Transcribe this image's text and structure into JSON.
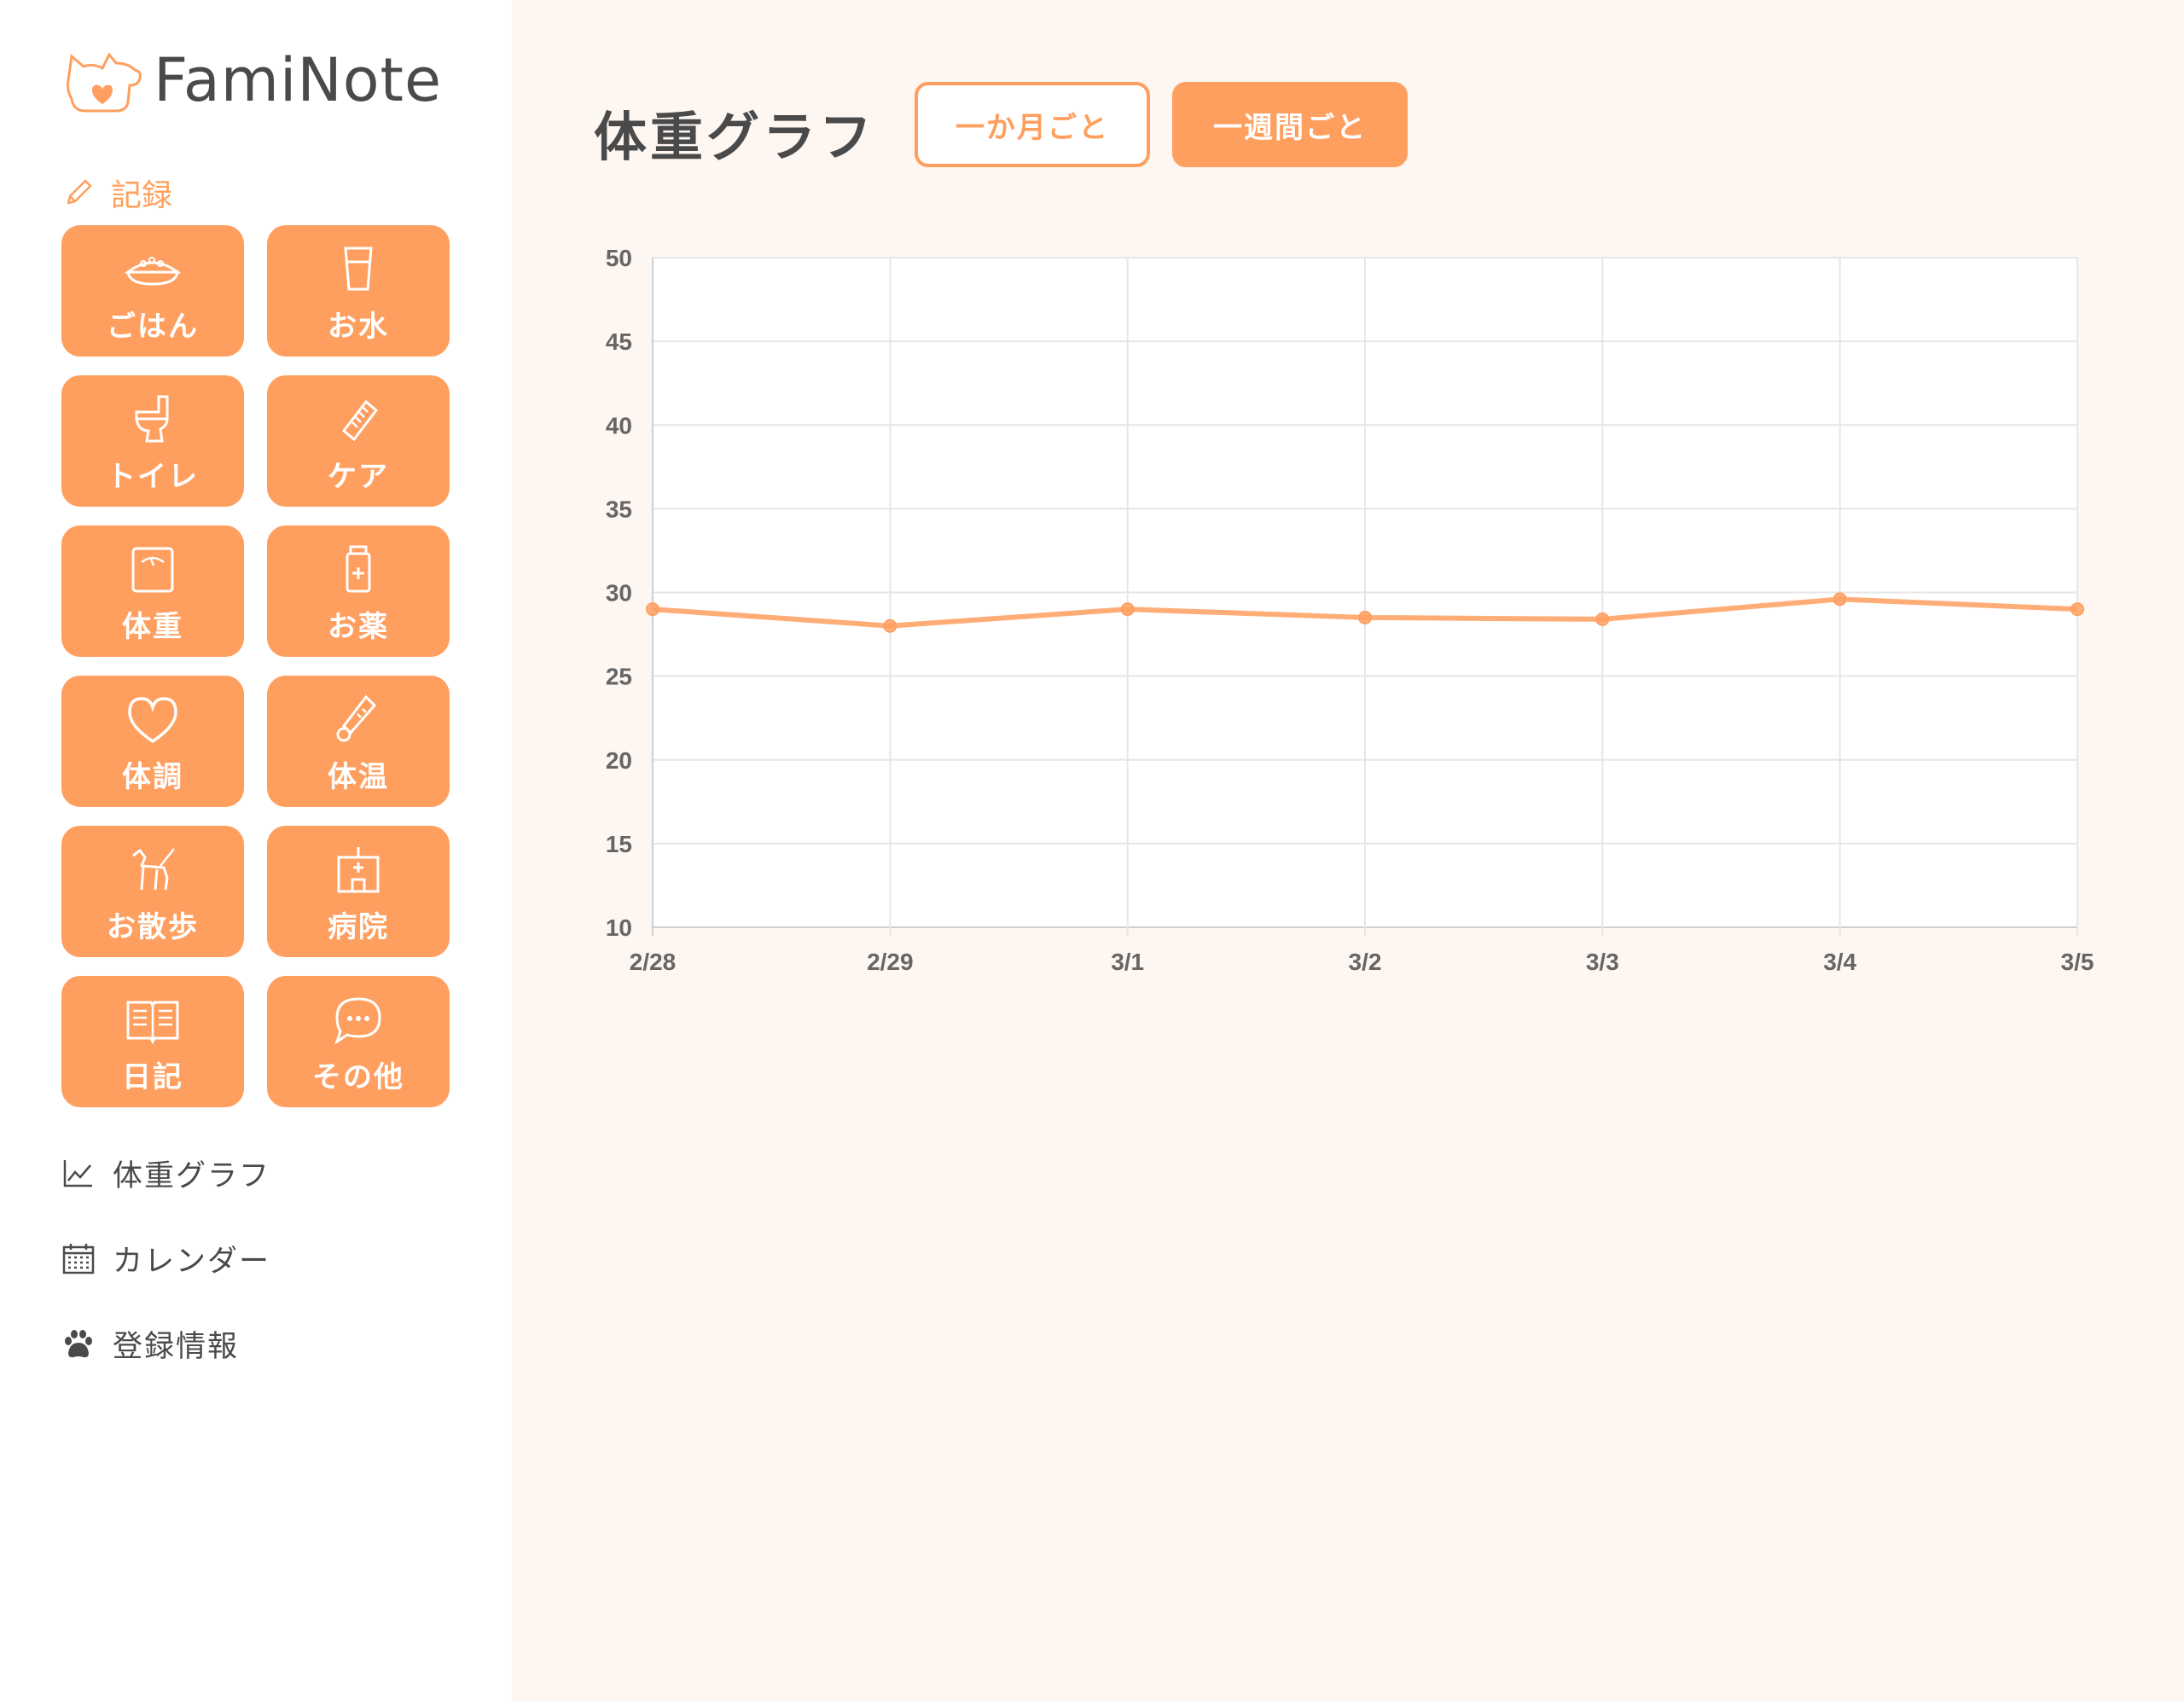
{
  "app": {
    "name": "FamiNote",
    "brand_color": "#ff9f5f",
    "logo_icon": "dog-cat-heart-logo"
  },
  "sidebar": {
    "record_section": {
      "label": "記録",
      "icon": "pencil-icon"
    },
    "tiles": [
      {
        "label": "ごはん",
        "icon": "food-bowl-icon"
      },
      {
        "label": "お水",
        "icon": "water-glass-icon"
      },
      {
        "label": "トイレ",
        "icon": "toilet-icon"
      },
      {
        "label": "ケア",
        "icon": "brush-icon"
      },
      {
        "label": "体重",
        "icon": "scale-icon"
      },
      {
        "label": "お薬",
        "icon": "medicine-bottle-icon"
      },
      {
        "label": "体調",
        "icon": "heart-icon"
      },
      {
        "label": "体温",
        "icon": "thermometer-icon"
      },
      {
        "label": "お散歩",
        "icon": "dog-walk-icon"
      },
      {
        "label": "病院",
        "icon": "hospital-icon"
      },
      {
        "label": "日記",
        "icon": "open-book-icon"
      },
      {
        "label": "その他",
        "icon": "speech-bubble-icon"
      }
    ],
    "nav": [
      {
        "label": "体重グラフ",
        "icon": "line-chart-icon"
      },
      {
        "label": "カレンダー",
        "icon": "calendar-icon"
      },
      {
        "label": "登録情報",
        "icon": "paw-icon"
      }
    ]
  },
  "main": {
    "title": "体重グラフ",
    "buttons": {
      "monthly": "一か月ごと",
      "weekly": "一週間ごと"
    },
    "selected_period": "一週間ごと"
  },
  "chart_data": {
    "type": "line",
    "categories": [
      "2/28",
      "2/29",
      "3/1",
      "3/2",
      "3/3",
      "3/4",
      "3/5"
    ],
    "series": [
      {
        "values": [
          29.0,
          28.0,
          29.0,
          28.5,
          28.4,
          29.6,
          29.0
        ],
        "color": "#ff9f5f"
      }
    ],
    "ylim": [
      10,
      50
    ],
    "yticks": [
      10,
      15,
      20,
      25,
      30,
      35,
      40,
      45,
      50
    ],
    "grid": true,
    "xlabel": "",
    "ylabel": ""
  }
}
